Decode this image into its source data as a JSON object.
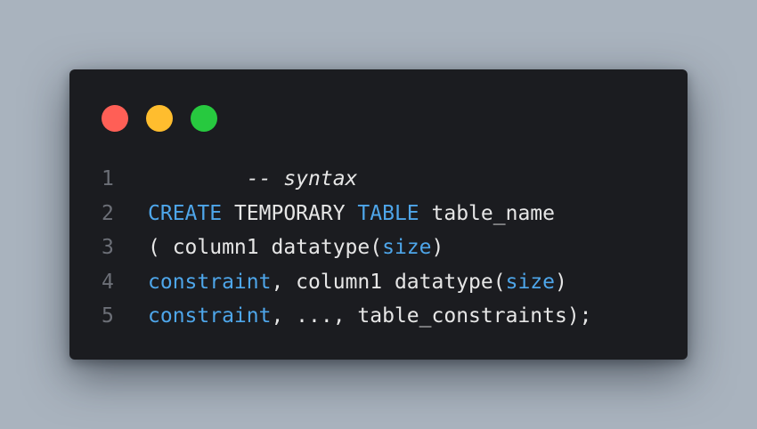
{
  "window": {
    "controls": [
      {
        "name": "close",
        "color": "#ff5f56"
      },
      {
        "name": "minimize",
        "color": "#ffbd2e"
      },
      {
        "name": "maximize",
        "color": "#27c93f"
      }
    ]
  },
  "code": {
    "lines": [
      {
        "number": "1",
        "tokens": [
          {
            "text": "-- syntax",
            "type": "comment"
          }
        ]
      },
      {
        "number": "2",
        "tokens": [
          {
            "text": "CREATE",
            "type": "keyword"
          },
          {
            "text": " TEMPORARY ",
            "type": "plain"
          },
          {
            "text": "TABLE",
            "type": "keyword"
          },
          {
            "text": " table_name",
            "type": "plain"
          }
        ]
      },
      {
        "number": "3",
        "tokens": [
          {
            "text": "( column1 datatype(",
            "type": "plain"
          },
          {
            "text": "size",
            "type": "keyword"
          },
          {
            "text": ")",
            "type": "plain"
          }
        ]
      },
      {
        "number": "4",
        "tokens": [
          {
            "text": "constraint",
            "type": "keyword"
          },
          {
            "text": ", column1 datatype(",
            "type": "plain"
          },
          {
            "text": "size",
            "type": "keyword"
          },
          {
            "text": ")",
            "type": "plain"
          }
        ]
      },
      {
        "number": "5",
        "tokens": [
          {
            "text": "constraint",
            "type": "keyword"
          },
          {
            "text": ", ..., table_constraints);",
            "type": "plain"
          }
        ]
      }
    ]
  }
}
